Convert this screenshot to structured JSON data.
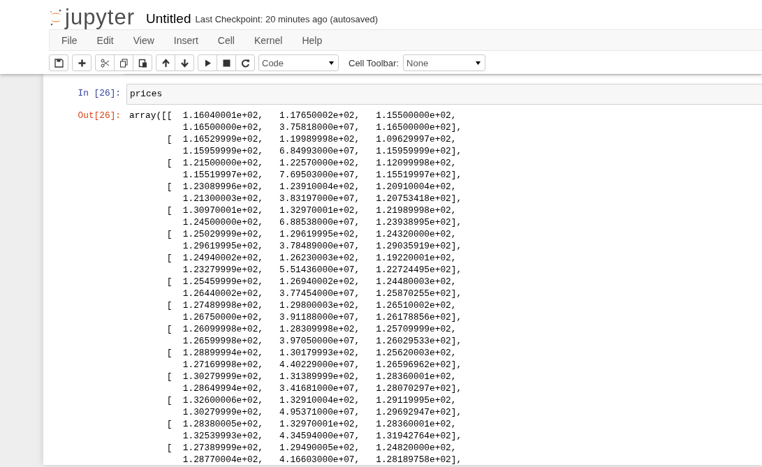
{
  "header": {
    "logo_text": "jupyter",
    "notebook_name": "Untitled",
    "checkpoint": "Last Checkpoint: 20 minutes ago (autosaved)"
  },
  "menu": [
    "File",
    "Edit",
    "View",
    "Insert",
    "Cell",
    "Kernel",
    "Help"
  ],
  "toolbar": {
    "cell_type": "Code",
    "cell_toolbar_label": "Cell Toolbar:",
    "cell_toolbar_value": "None"
  },
  "cell": {
    "input_prompt": "In [26]:",
    "code": "prices",
    "output_prompt": "Out[26]:",
    "output_lines": [
      "array([[  1.16040001e+02,   1.17650002e+02,   1.15500000e+02,",
      "          1.16500000e+02,   3.75818000e+07,   1.16500000e+02],",
      "       [  1.16529999e+02,   1.19989998e+02,   1.09629997e+02,",
      "          1.15959999e+02,   6.84993000e+07,   1.15959999e+02],",
      "       [  1.21500000e+02,   1.22570000e+02,   1.12099998e+02,",
      "          1.15519997e+02,   7.69503000e+07,   1.15519997e+02],",
      "       [  1.23089996e+02,   1.23910004e+02,   1.20910004e+02,",
      "          1.21300003e+02,   3.83197000e+07,   1.20753418e+02],",
      "       [  1.30970001e+02,   1.32970001e+02,   1.21989998e+02,",
      "          1.24500000e+02,   6.88538000e+07,   1.23938995e+02],",
      "       [  1.25029999e+02,   1.29619995e+02,   1.24320000e+02,",
      "          1.29619995e+02,   3.78489000e+07,   1.29035919e+02],",
      "       [  1.24940002e+02,   1.26230003e+02,   1.19220001e+02,",
      "          1.23279999e+02,   5.51436000e+07,   1.22724495e+02],",
      "       [  1.25459999e+02,   1.26940002e+02,   1.24480003e+02,",
      "          1.26440002e+02,   3.77454000e+07,   1.25870255e+02],",
      "       [  1.27489998e+02,   1.29800003e+02,   1.26510002e+02,",
      "          1.26750000e+02,   3.91188000e+07,   1.26178856e+02],",
      "       [  1.26099998e+02,   1.28309998e+02,   1.25709999e+02,",
      "          1.26599998e+02,   3.97050000e+07,   1.26029533e+02],",
      "       [  1.28899994e+02,   1.30179993e+02,   1.25620003e+02,",
      "          1.27169998e+02,   4.40229000e+07,   1.26596962e+02],",
      "       [  1.30279999e+02,   1.31389999e+02,   1.28360001e+02,",
      "          1.28649994e+02,   3.41681000e+07,   1.28070297e+02],",
      "       [  1.32600006e+02,   1.32910004e+02,   1.29119995e+02,",
      "          1.30279999e+02,   4.95371000e+07,   1.29692947e+02],",
      "       [  1.28380005e+02,   1.32970001e+02,   1.28360001e+02,",
      "          1.32539993e+02,   4.34594000e+07,   1.31942764e+02],",
      "       [  1.27389999e+02,   1.29490005e+02,   1.24820000e+02,",
      "          1.28770004e+02,   4.16603000e+07,   1.28189758e+02],"
    ]
  }
}
